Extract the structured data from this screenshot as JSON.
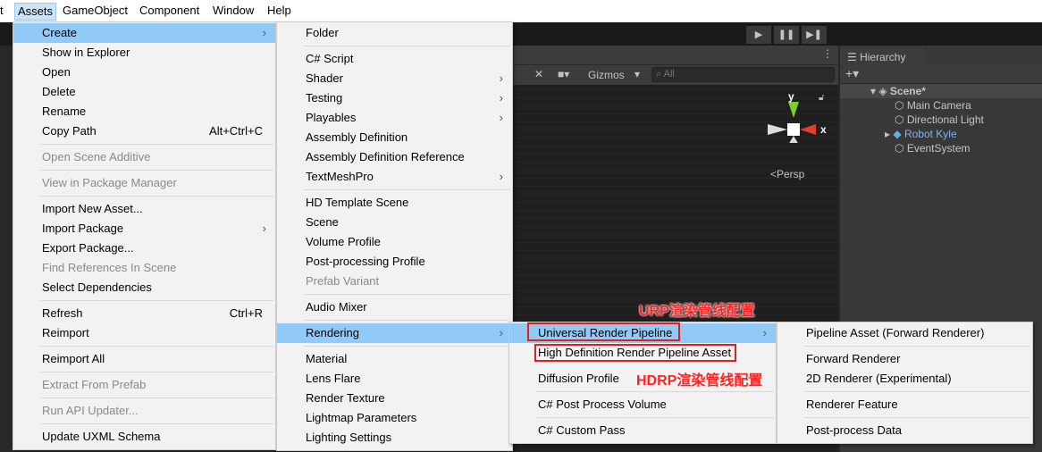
{
  "menubar": {
    "items": [
      "t",
      "Assets",
      "GameObject",
      "Component",
      "Window",
      "Help"
    ],
    "active": "Assets"
  },
  "toolbar": {
    "play": "▶",
    "pause": "❚❚",
    "step": "▶❚"
  },
  "scene_view": {
    "gizmos_label": "Gizmos",
    "search_placeholder": "All",
    "axis_y": "y",
    "axis_x": "x",
    "persp_label": "<Persp",
    "axis_colors": {
      "x": "#e0402a",
      "y": "#7ccf2a"
    }
  },
  "hierarchy": {
    "tab": "Hierarchy",
    "add": "+▾",
    "scene": "Scene*",
    "items": [
      {
        "label": "Main Camera"
      },
      {
        "label": "Directional Light"
      },
      {
        "label": "Robot Kyle",
        "prefab": true,
        "color": "#7fb2f0"
      },
      {
        "label": "EventSystem"
      }
    ]
  },
  "assets_menu": [
    {
      "label": "Create",
      "arrow": true,
      "hl": true
    },
    {
      "label": "Show in Explorer"
    },
    {
      "label": "Open"
    },
    {
      "label": "Delete"
    },
    {
      "label": "Rename"
    },
    {
      "label": "Copy Path",
      "shortcut": "Alt+Ctrl+C"
    },
    {
      "sep": true
    },
    {
      "label": "Open Scene Additive",
      "disabled": true
    },
    {
      "sep": true
    },
    {
      "label": "View in Package Manager",
      "disabled": true
    },
    {
      "sep": true
    },
    {
      "label": "Import New Asset..."
    },
    {
      "label": "Import Package",
      "arrow": true
    },
    {
      "label": "Export Package..."
    },
    {
      "label": "Find References In Scene",
      "disabled": true
    },
    {
      "label": "Select Dependencies"
    },
    {
      "sep": true
    },
    {
      "label": "Refresh",
      "shortcut": "Ctrl+R"
    },
    {
      "label": "Reimport"
    },
    {
      "sep": true
    },
    {
      "label": "Reimport All"
    },
    {
      "sep": true
    },
    {
      "label": "Extract From Prefab",
      "disabled": true
    },
    {
      "sep": true
    },
    {
      "label": "Run API Updater...",
      "disabled": true
    },
    {
      "sep": true
    },
    {
      "label": "Update UXML Schema"
    }
  ],
  "create_menu": [
    {
      "label": "Folder"
    },
    {
      "sep": true
    },
    {
      "label": "C# Script"
    },
    {
      "label": "Shader",
      "arrow": true
    },
    {
      "label": "Testing",
      "arrow": true
    },
    {
      "label": "Playables",
      "arrow": true
    },
    {
      "label": "Assembly Definition"
    },
    {
      "label": "Assembly Definition Reference"
    },
    {
      "label": "TextMeshPro",
      "arrow": true
    },
    {
      "sep": true
    },
    {
      "label": "HD Template Scene"
    },
    {
      "label": "Scene"
    },
    {
      "label": "Volume Profile"
    },
    {
      "label": "Post-processing Profile"
    },
    {
      "label": "Prefab Variant",
      "disabled": true
    },
    {
      "sep": true
    },
    {
      "label": "Audio Mixer"
    },
    {
      "sep": true
    },
    {
      "label": "Rendering",
      "arrow": true,
      "hl": true
    },
    {
      "sep": true
    },
    {
      "label": "Material"
    },
    {
      "label": "Lens Flare"
    },
    {
      "label": "Render Texture"
    },
    {
      "label": "Lightmap Parameters"
    },
    {
      "label": "Lighting Settings"
    }
  ],
  "rendering_menu": [
    {
      "label": "Universal Render Pipeline",
      "arrow": true,
      "hl": true
    },
    {
      "label": "High Definition Render Pipeline Asset"
    },
    {
      "gap": true
    },
    {
      "label": "Diffusion Profile"
    },
    {
      "sep": true
    },
    {
      "label": "C# Post Process Volume"
    },
    {
      "sep": true
    },
    {
      "label": "C# Custom Pass"
    }
  ],
  "urp_menu": [
    {
      "label": "Pipeline Asset (Forward Renderer)"
    },
    {
      "sep": true
    },
    {
      "label": "Forward Renderer"
    },
    {
      "label": "2D Renderer (Experimental)"
    },
    {
      "sep": true
    },
    {
      "label": "Renderer Feature"
    },
    {
      "sep": true
    },
    {
      "label": "Post-process Data"
    }
  ],
  "annotations": {
    "urp": "URP渲染管线配置",
    "hdrp": "HDRP渲染管线配置",
    "color": "#ff2020"
  }
}
